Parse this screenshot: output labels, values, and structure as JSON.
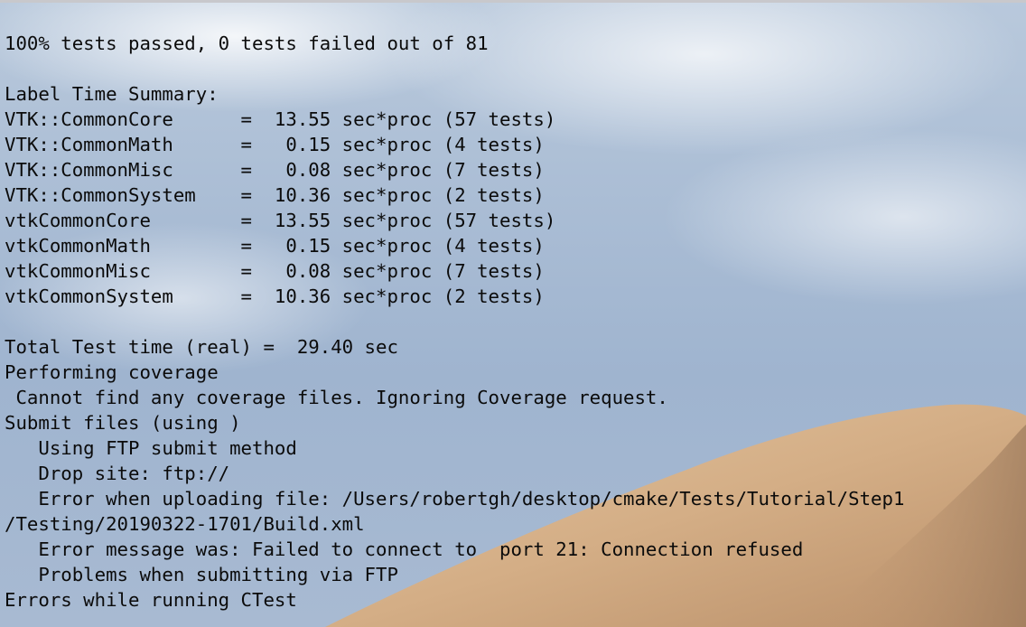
{
  "terminal": {
    "lines": [
      "100% tests passed, 0 tests failed out of 81",
      "",
      "Label Time Summary:",
      "VTK::CommonCore      =  13.55 sec*proc (57 tests)",
      "VTK::CommonMath      =   0.15 sec*proc (4 tests)",
      "VTK::CommonMisc      =   0.08 sec*proc (7 tests)",
      "VTK::CommonSystem    =  10.36 sec*proc (2 tests)",
      "vtkCommonCore        =  13.55 sec*proc (57 tests)",
      "vtkCommonMath        =   0.15 sec*proc (4 tests)",
      "vtkCommonMisc        =   0.08 sec*proc (7 tests)",
      "vtkCommonSystem      =  10.36 sec*proc (2 tests)",
      "",
      "Total Test time (real) =  29.40 sec",
      "Performing coverage",
      " Cannot find any coverage files. Ignoring Coverage request.",
      "Submit files (using )",
      "   Using FTP submit method",
      "   Drop site: ftp://",
      "   Error when uploading file: /Users/robertgh/desktop/cmake/Tests/Tutorial/Step1",
      "/Testing/20190322-1701/Build.xml",
      "   Error message was: Failed to connect to  port 21: Connection refused",
      "   Problems when submitting via FTP",
      "Errors while running CTest"
    ]
  }
}
